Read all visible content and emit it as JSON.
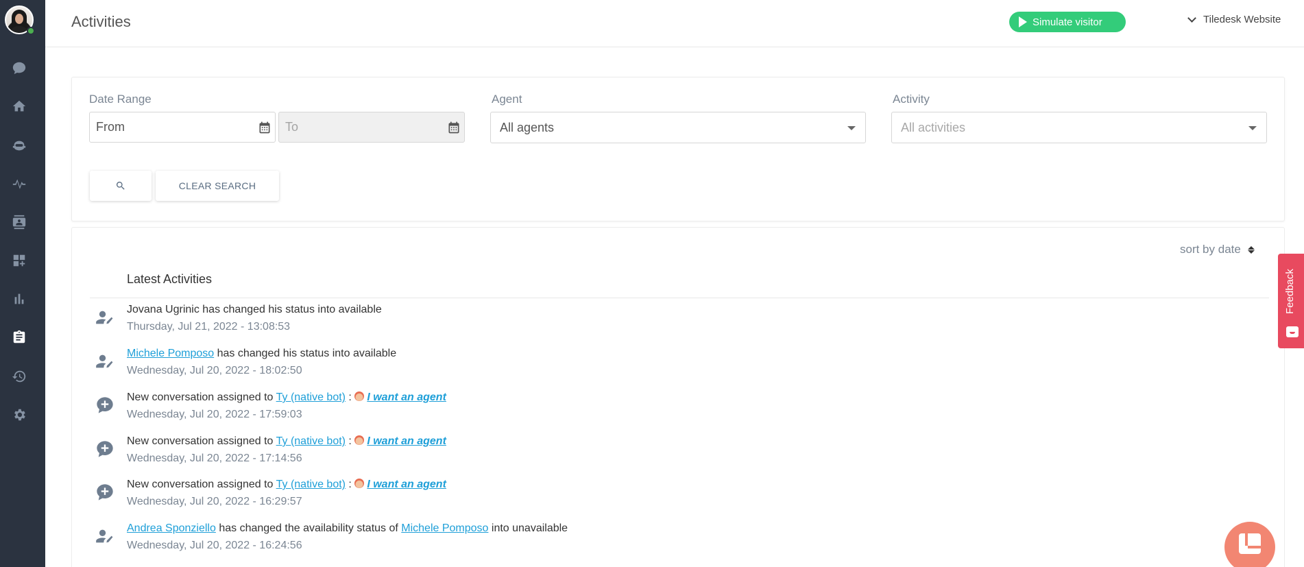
{
  "header": {
    "title": "Activities",
    "simulate_label": "Simulate visitor",
    "project_name": "Tiledesk Website"
  },
  "sidebar": {
    "items": [
      {
        "name": "conversations",
        "icon": "chat-bubble-icon"
      },
      {
        "name": "home",
        "icon": "home-icon"
      },
      {
        "name": "bots",
        "icon": "bot-icon"
      },
      {
        "name": "monitor",
        "icon": "activity-pulse-icon"
      },
      {
        "name": "contacts",
        "icon": "contacts-icon"
      },
      {
        "name": "apps",
        "icon": "apps-icon"
      },
      {
        "name": "analytics",
        "icon": "bar-chart-icon"
      },
      {
        "name": "activities",
        "icon": "clipboard-icon",
        "active": true
      },
      {
        "name": "history",
        "icon": "history-icon"
      },
      {
        "name": "settings",
        "icon": "gear-icon"
      }
    ]
  },
  "filters": {
    "date_range_label": "Date Range",
    "from_placeholder": "From",
    "to_placeholder": "To",
    "agent_label": "Agent",
    "agent_value": "All agents",
    "activity_label": "Activity",
    "activity_placeholder": "All activities",
    "clear_label": "CLEAR SEARCH"
  },
  "activities": {
    "sort_label": "sort by date",
    "title": "Latest Activities",
    "rows": [
      {
        "type": "status",
        "actor": "Jovana Ugrinic",
        "actor_linked": false,
        "text": " has changed his status into available",
        "date": "Thursday, Jul 21, 2022 - 13:08:53"
      },
      {
        "type": "status",
        "actor": "Michele Pomposo",
        "actor_linked": true,
        "text": " has changed his status into available",
        "date": "Wednesday, Jul 20, 2022 - 18:02:50"
      },
      {
        "type": "conversation",
        "prefix": "New conversation assigned to ",
        "assignee": "Ty (native bot)",
        "separator": " : ",
        "message": "I want an agent",
        "date": "Wednesday, Jul 20, 2022 - 17:59:03"
      },
      {
        "type": "conversation",
        "prefix": "New conversation assigned to ",
        "assignee": "Ty (native bot)",
        "separator": " : ",
        "message": "I want an agent",
        "date": "Wednesday, Jul 20, 2022 - 17:14:56"
      },
      {
        "type": "conversation",
        "prefix": "New conversation assigned to ",
        "assignee": "Ty (native bot)",
        "separator": " : ",
        "message": "I want an agent",
        "date": "Wednesday, Jul 20, 2022 - 16:29:57"
      },
      {
        "type": "availability",
        "actor": "Andrea Sponziello",
        "middle": " has changed the availability status of ",
        "target": "Michele Pomposo",
        "suffix": " into unavailable",
        "date": "Wednesday, Jul 20, 2022 - 16:24:56"
      }
    ]
  },
  "feedback_label": "Feedback",
  "colors": {
    "sidebar_bg": "#2b3340",
    "accent_green": "#33cc7a",
    "link_blue": "#1e9fd8",
    "feedback_red": "#e84a5f",
    "launcher_coral": "#f28672"
  }
}
